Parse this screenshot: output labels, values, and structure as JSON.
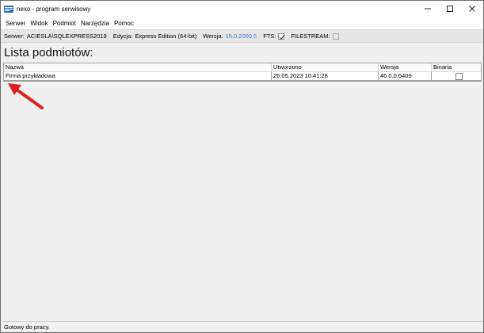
{
  "window": {
    "title": "nexo - program serwisowy",
    "controls": [
      "minimize",
      "maximize",
      "close"
    ]
  },
  "menu": {
    "items": [
      "Serwer",
      "Widok",
      "Podmiot",
      "Narzędzia",
      "Pomoc"
    ]
  },
  "infobar": {
    "server_label": "Serwer:",
    "server_value": "ACIESLA\\SQLEXPRESS2019",
    "edition_label": "Edycja:",
    "edition_value": "Express Edition (64-bit)",
    "version_label": "Wersja:",
    "version_value": "15.0.2000.5",
    "fts_label": "FTS:",
    "fts_checked": true,
    "filestream_label": "FILESTREAM:",
    "filestream_checked": false,
    "version_color": "#3a7bd5"
  },
  "page": {
    "title": "Lista podmiotów:"
  },
  "grid": {
    "columns": [
      "Nazwa",
      "Utworzono",
      "Wersja",
      "Binaria"
    ],
    "rows": [
      {
        "name": "Firma przykładowa",
        "created": "26.05.2023 10:41:28",
        "version": "46.0.0.6409",
        "binaria": false
      }
    ]
  },
  "annotation": {
    "icon": "red-arrow-icon",
    "color": "#e02020"
  },
  "status": {
    "text": "Gotowy do pracy."
  }
}
